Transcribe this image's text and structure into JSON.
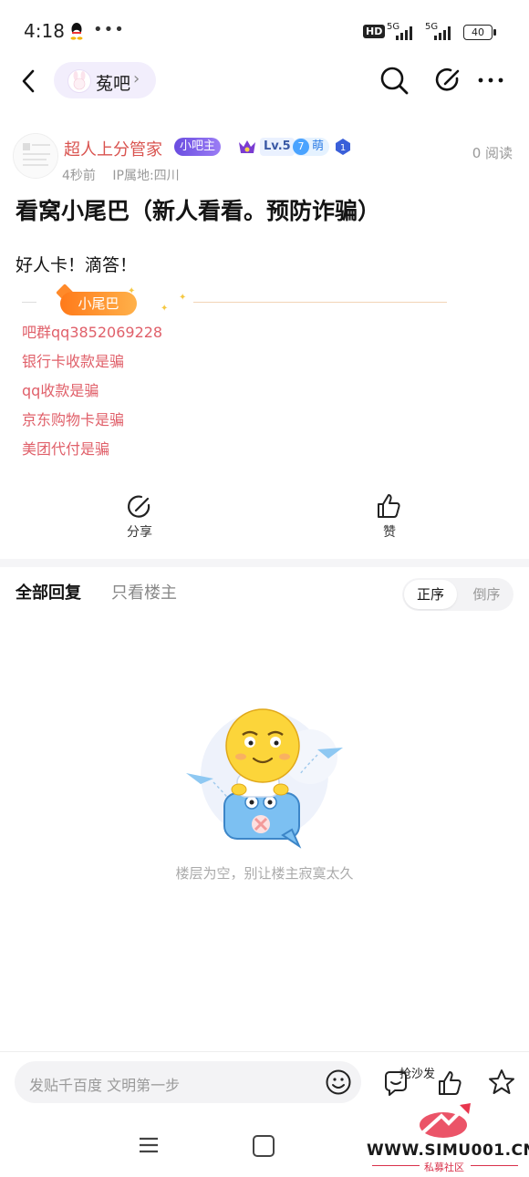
{
  "status_bar": {
    "time": "4:18",
    "signal1": "5G",
    "signal2": "5G",
    "hd": "HD",
    "battery": "40"
  },
  "header": {
    "forum_name": "菟吧",
    "forum_chevron": "›"
  },
  "post": {
    "author": "超人上分管家",
    "badge_admin": "小吧主",
    "badge_level": "Lv.5",
    "badge_meng_num": "7",
    "badge_meng": "萌",
    "reads": "0 阅读",
    "time_ago": "4秒前",
    "ip": "IP属地:四川",
    "title": "看窝小尾巴（新人看看。预防诈骗）",
    "body": "好人卡！滴答！",
    "tail_label": "小尾巴",
    "tail_lines": [
      "吧群qq3852069228",
      "银行卡收款是骗",
      "qq收款是骗",
      "京东购物卡是骗",
      "美团代付是骗"
    ]
  },
  "actions": {
    "share": "分享",
    "like": "赞"
  },
  "replies": {
    "tab_all": "全部回复",
    "tab_only_op": "只看楼主",
    "sort_asc": "正序",
    "sort_desc": "倒序",
    "empty_text": "楼层为空，别让楼主寂寞太久"
  },
  "bottom": {
    "input_placeholder": "发贴千百度 文明第一步",
    "sofa": "抢沙发"
  },
  "watermark": {
    "site": "WWW.SIMU001.CN",
    "sub": "私募社区"
  },
  "colors": {
    "author": "#d9534f",
    "tail": "#e0606a",
    "accent": "#6a4de0"
  }
}
